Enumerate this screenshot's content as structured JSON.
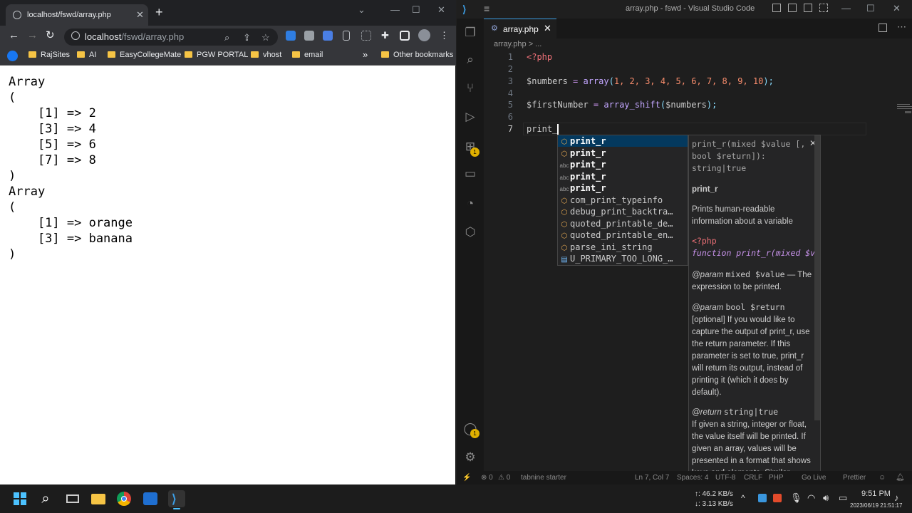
{
  "browser": {
    "tab_title": "localhost/fswd/array.php",
    "tab_close": "✕",
    "new_tab": "+",
    "url_host": "localhost",
    "url_path": "/fswd/array.php",
    "bookmarks": [
      "RajSites",
      "AI",
      "EasyCollegeMate",
      "PGW PORTAL",
      "vhost",
      "email"
    ],
    "bookmarks_overflow": "»",
    "other_bookmarks": "Other bookmarks",
    "page_output": "Array\n(\n    [1] => 2\n    [3] => 4\n    [5] => 6\n    [7] => 8\n)\nArray\n(\n    [1] => orange\n    [3] => banana\n)"
  },
  "vscode": {
    "window_title": "array.php - fswd - Visual Studio Code",
    "tab": {
      "name": "array.php",
      "close": "✕"
    },
    "breadcrumb": "array.php > ...",
    "line_numbers": [
      "1",
      "2",
      "3",
      "4",
      "5",
      "6",
      "7"
    ],
    "code": {
      "l1": "<?php",
      "l3_var": "$numbers",
      "l3_eq": " = ",
      "l3_fn": "array",
      "l3_args": "1, 2, 3, 4, 5, 6, 7, 8, 9, 10",
      "l5_var": "$firstNumber",
      "l5_fn": "array_shift",
      "l5_arg": "$numbers",
      "l7": "print_"
    },
    "badges": {
      "extensions": "1",
      "accounts": "1"
    },
    "suggestions": [
      {
        "icon": "cube",
        "label": "print_r"
      },
      {
        "icon": "cube",
        "label": "print_r"
      },
      {
        "icon": "abc",
        "label": "print_r"
      },
      {
        "icon": "abc",
        "label": "print_r"
      },
      {
        "icon": "abc",
        "label": "print_r"
      },
      {
        "icon": "cube",
        "label": "com_print_typeinfo"
      },
      {
        "icon": "cube",
        "label": "debug_print_backtra…"
      },
      {
        "icon": "cube",
        "label": "quoted_printable_de…"
      },
      {
        "icon": "cube",
        "label": "quoted_printable_en…"
      },
      {
        "icon": "cube",
        "label": "parse_ini_string"
      },
      {
        "icon": "enum",
        "label": "U_PRIMARY_TOO_LONG_…"
      }
    ],
    "doc": {
      "signature": "print_r(mixed $value [, bool $return]): string|true",
      "name": "print_r",
      "summary": "Prints human-readable information about a variable",
      "example_open": "<?php",
      "example_fn": "function print_r(mixed $value",
      "param1_tag": "@param",
      "param1_type": "mixed $value",
      "param1_desc": "— The expression to be printed.",
      "param2_tag": "@param",
      "param2_type": "bool $return",
      "param2_desc": "[optional] If you would like to capture the output of print_r, use the return parameter. If this parameter is set to true, print_r will return its output, instead of printing it (which it does by default).",
      "return_tag": "@return",
      "return_type": "string|true",
      "return_desc": "If given a string, integer or float, the value itself will be printed. If given an array, values will be presented in a format that shows keys and elements. Similar",
      "close": "✕"
    },
    "status": {
      "errors": "⊗ 0",
      "warnings": "⚠ 0",
      "tabnine": "tabnine starter",
      "position": "Ln 7, Col 7",
      "spaces": "Spaces: 4",
      "encoding": "UTF-8",
      "eol": "CRLF",
      "language": "PHP",
      "golive": "Go Live",
      "prettier": "Prettier"
    }
  },
  "taskbar": {
    "net_up": "↑: 46.2 KB/s",
    "net_down": "↓: 3.13 KB/s",
    "time": "9:51 PM",
    "date": "2023/06/19 21:51:17"
  }
}
